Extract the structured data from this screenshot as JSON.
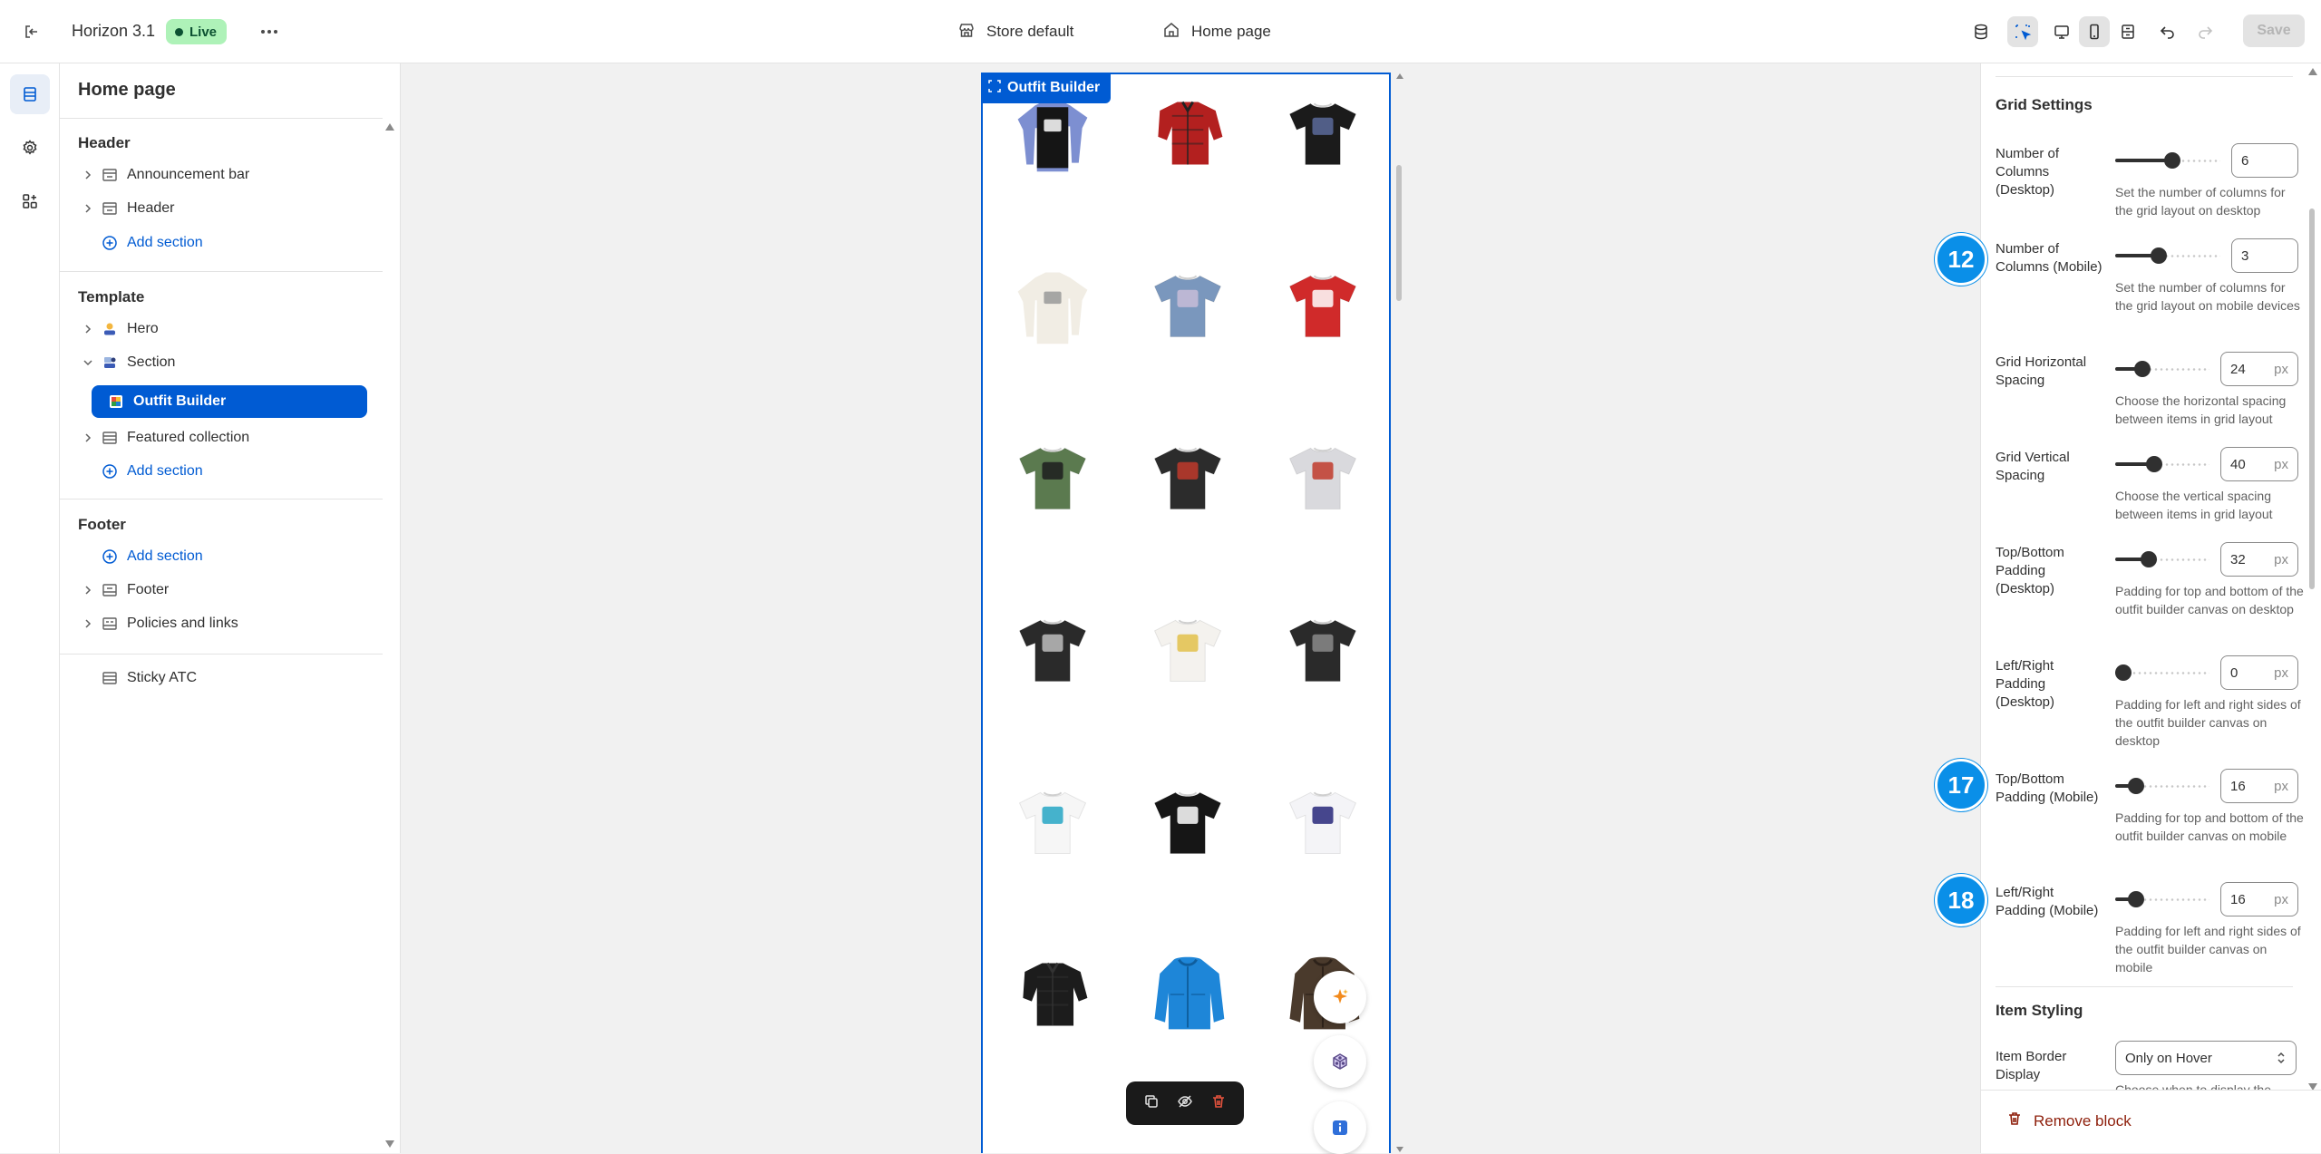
{
  "topbar": {
    "theme_name": "Horizon 3.1",
    "status_badge": "Live",
    "store_selector": "Store default",
    "page_selector": "Home page",
    "save_label": "Save"
  },
  "sidebar": {
    "title": "Home page",
    "header_group": "Header",
    "header_items": [
      "Announcement bar",
      "Header"
    ],
    "template_group": "Template",
    "template_items": [
      "Hero",
      "Section",
      "Outfit Builder",
      "Featured collection"
    ],
    "footer_group": "Footer",
    "footer_items": [
      "Footer",
      "Policies and links"
    ],
    "add_section": "Add section",
    "extra_item": "Sticky ATC"
  },
  "canvas": {
    "selected_block": "Outfit Builder",
    "products": [
      {
        "kind": "longsleeve",
        "body": "#151515",
        "sleeve": "#7d8fd1",
        "print": "#ffffff"
      },
      {
        "kind": "shirt",
        "body": "#b3201f",
        "sleeve": "#b3201f",
        "print": "#222222"
      },
      {
        "kind": "tee",
        "body": "#1b1b1b",
        "sleeve": "#1b1b1b",
        "print": "#5a6a9a"
      },
      {
        "kind": "longsleeve",
        "body": "#f1ede4",
        "sleeve": "#f1ede4",
        "print": "#999999"
      },
      {
        "kind": "tee",
        "body": "#7a97bd",
        "sleeve": "#7a97bd",
        "print": "#c8bcd8"
      },
      {
        "kind": "tee",
        "body": "#d02a2a",
        "sleeve": "#d02a2a",
        "print": "#ffffff"
      },
      {
        "kind": "tee",
        "body": "#5b7a4f",
        "sleeve": "#5b7a4f",
        "print": "#1d1d1d"
      },
      {
        "kind": "tee",
        "body": "#2c2c2c",
        "sleeve": "#2c2c2c",
        "print": "#c0392b"
      },
      {
        "kind": "tee",
        "body": "#d9d9dd",
        "sleeve": "#d9d9dd",
        "print": "#c0392b"
      },
      {
        "kind": "tee",
        "body": "#2a2a2a",
        "sleeve": "#2a2a2a",
        "print": "#bdbdbd"
      },
      {
        "kind": "tee",
        "body": "#f4f2ee",
        "sleeve": "#f4f2ee",
        "print": "#e2c14a"
      },
      {
        "kind": "tee",
        "body": "#2a2a2a",
        "sleeve": "#2a2a2a",
        "print": "#8a8a8a"
      },
      {
        "kind": "tee",
        "body": "#f6f6f6",
        "sleeve": "#f6f6f6",
        "print": "#26a6c4"
      },
      {
        "kind": "tee",
        "body": "#161616",
        "sleeve": "#161616",
        "print": "#ffffff"
      },
      {
        "kind": "tee",
        "body": "#f4f4f7",
        "sleeve": "#f4f4f7",
        "print": "#27277a"
      },
      {
        "kind": "shirt",
        "body": "#1c1c1c",
        "sleeve": "#1c1c1c",
        "print": "#333333"
      },
      {
        "kind": "jacket",
        "body": "#1e86d8",
        "sleeve": "#1e86d8",
        "print": "#0f5e9e"
      },
      {
        "kind": "jacket",
        "body": "#4a3a2c",
        "sleeve": "#4a3a2c",
        "print": "#2d221a"
      }
    ]
  },
  "settings": {
    "grid_heading": "Grid Settings",
    "fields": [
      {
        "label": "Number of Columns (Desktop)",
        "value": "6",
        "unit": "",
        "level": 0.55,
        "help": "Set the number of columns for the grid layout on desktop"
      },
      {
        "label": "Number of Columns (Mobile)",
        "value": "3",
        "unit": "",
        "level": 0.4,
        "help": "Set the number of columns for the grid layout on mobile devices"
      },
      {
        "label": "Grid Horizontal Spacing",
        "value": "24",
        "unit": "px",
        "level": 0.24,
        "help": "Choose the horizontal spacing between items in grid layout"
      },
      {
        "label": "Grid Vertical Spacing",
        "value": "40",
        "unit": "px",
        "level": 0.4,
        "help": "Choose the vertical spacing between items in grid layout"
      },
      {
        "label": "Top/Bottom Padding (Desktop)",
        "value": "32",
        "unit": "px",
        "level": 0.32,
        "help": "Padding for top and bottom of the outfit builder canvas on desktop"
      },
      {
        "label": "Left/Right Padding (Desktop)",
        "value": "0",
        "unit": "px",
        "level": 0.0,
        "help": "Padding for left and right sides of the outfit builder canvas on desktop"
      },
      {
        "label": "Top/Bottom Padding (Mobile)",
        "value": "16",
        "unit": "px",
        "level": 0.16,
        "help": "Padding for top and bottom of the outfit builder canvas on mobile"
      },
      {
        "label": "Left/Right Padding (Mobile)",
        "value": "16",
        "unit": "px",
        "level": 0.16,
        "help": "Padding for left and right sides of the outfit builder canvas on mobile"
      }
    ],
    "styling_heading": "Item Styling",
    "border_label": "Item Border Display",
    "border_value": "Only on Hover",
    "border_help": "Choose when to display the",
    "remove_label": "Remove block"
  },
  "callouts": [
    "12",
    "17",
    "18"
  ],
  "colors": {
    "accent": "#005bd3",
    "callout": "#0a8fe8",
    "danger": "#8e1f0b",
    "live_bg": "#aef2b8"
  }
}
